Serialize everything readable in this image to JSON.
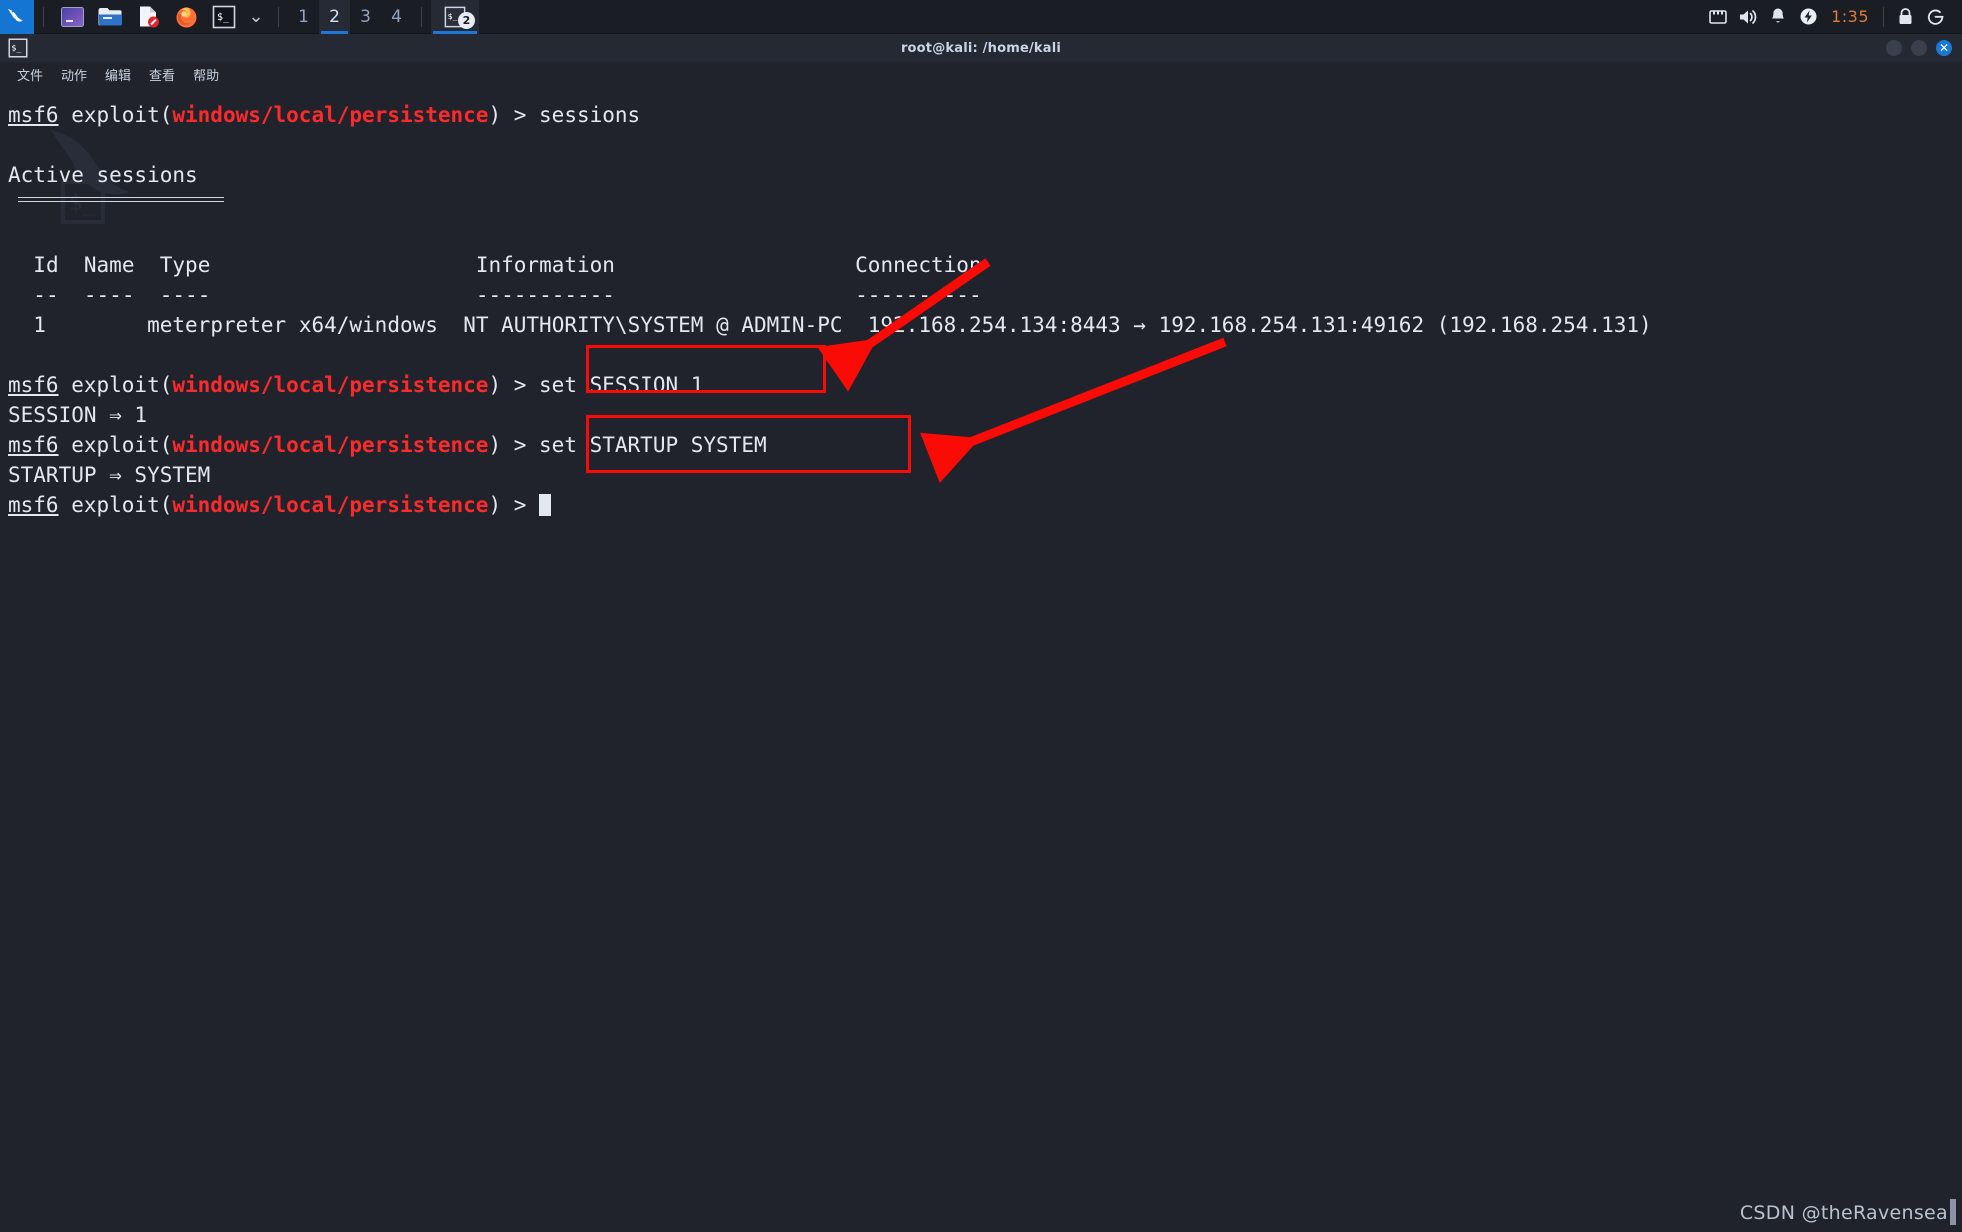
{
  "taskbar": {
    "launcher": {
      "name": "kali-menu",
      "icon": "kali-dragon-icon"
    },
    "quick_launch": [
      {
        "name": "terminal-emulator",
        "icon": "terminal-window-icon"
      },
      {
        "name": "file-manager",
        "icon": "folder-icon"
      },
      {
        "name": "text-editor",
        "icon": "document-forbidden-icon"
      },
      {
        "name": "firefox",
        "icon": "firefox-icon"
      },
      {
        "name": "terminal-dropdown",
        "icon": "terminal-prompt-icon"
      }
    ],
    "dropdown_arrow": "⌄",
    "workspaces": [
      {
        "label": "1",
        "active": false
      },
      {
        "label": "2",
        "active": true
      },
      {
        "label": "3",
        "active": false
      },
      {
        "label": "4",
        "active": false
      }
    ],
    "tasks": [
      {
        "name": "terminal-task",
        "icon": "terminal-prompt-icon",
        "badge": "2"
      }
    ],
    "tray": [
      {
        "name": "network-icon",
        "glyph": "network"
      },
      {
        "name": "volume-icon",
        "glyph": "volume"
      },
      {
        "name": "notifications-bell-icon",
        "glyph": "bell"
      },
      {
        "name": "power-icon",
        "glyph": "bolt"
      }
    ],
    "clock": "1:35",
    "tray_right": [
      {
        "name": "lock-screen-icon",
        "glyph": "lock"
      },
      {
        "name": "logout-icon",
        "glyph": "logout"
      }
    ]
  },
  "window": {
    "title": "root@kali: /home/kali",
    "icon": "terminal-prompt-icon",
    "controls": {
      "minimize": "",
      "maximize": "",
      "close": "✕"
    }
  },
  "menubar": {
    "items": [
      {
        "label": "文件"
      },
      {
        "label": "动作"
      },
      {
        "label": "编辑"
      },
      {
        "label": "查看"
      },
      {
        "label": "帮助"
      }
    ]
  },
  "terminal": {
    "prompt": {
      "user": "msf6",
      "module_open": " exploit(",
      "module": "windows/local/persistence",
      "module_close": ") > "
    },
    "lines": {
      "cmd_sessions": "sessions",
      "blank": "",
      "active_sessions_heading": "Active sessions",
      "table": {
        "headers": {
          "id": "Id",
          "name": "Name",
          "type": "Type",
          "information": "Information",
          "connection": "Connection"
        },
        "dashes": {
          "id": "--",
          "name": "----",
          "type": "----",
          "information": "-----------",
          "connection": "----------"
        },
        "rows": [
          {
            "id": "1",
            "name": "",
            "type": "meterpreter x64/windows",
            "information": "NT AUTHORITY\\SYSTEM @ ADMIN-PC",
            "connection": "192.168.254.134:8443 → 192.168.254.131:49162 (192.168.254.131)"
          }
        ]
      },
      "cmd_set_session": "set SESSION 1",
      "out_session": "SESSION ⇒ 1",
      "cmd_set_startup": "set STARTUP SYSTEM",
      "out_startup": "STARTUP ⇒ SYSTEM"
    }
  },
  "annotations": {
    "color": "#fb0b05",
    "boxes": [
      {
        "name": "highlight-box-set-session",
        "target": "set SESSION 1"
      },
      {
        "name": "highlight-box-set-startup",
        "target": "set STARTUP SYSTEM"
      }
    ],
    "arrows": [
      {
        "name": "arrow-to-set-session",
        "points_to": "set SESSION 1"
      },
      {
        "name": "arrow-to-set-startup",
        "points_to": "set STARTUP SYSTEM"
      }
    ]
  },
  "watermark": {
    "text": "CSDN @theRavensea"
  }
}
